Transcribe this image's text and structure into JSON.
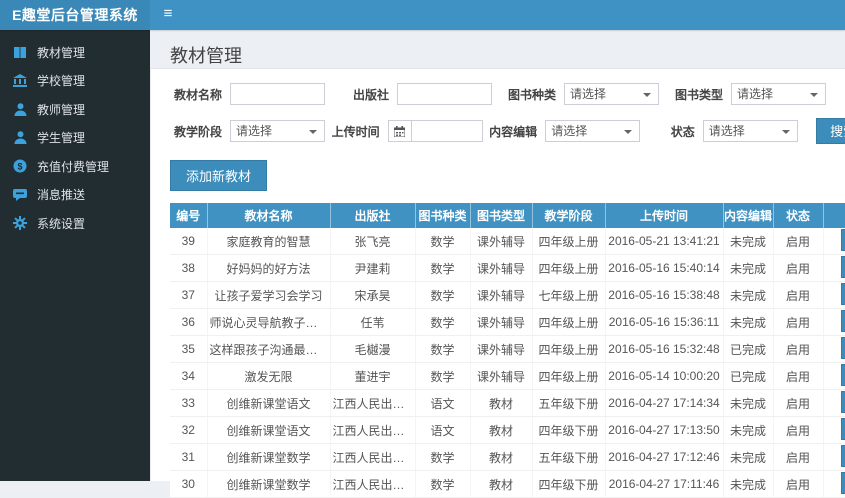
{
  "app": {
    "title": "E趣堂后台管理系统"
  },
  "topbar": {
    "menu_toggle": "≡"
  },
  "sidebar": {
    "items": [
      {
        "icon": "book-icon",
        "label": "教材管理"
      },
      {
        "icon": "school-icon",
        "label": "学校管理"
      },
      {
        "icon": "teacher-icon",
        "label": "教师管理"
      },
      {
        "icon": "student-icon",
        "label": "学生管理"
      },
      {
        "icon": "payment-icon",
        "label": "充值付费管理"
      },
      {
        "icon": "message-icon",
        "label": "消息推送"
      },
      {
        "icon": "settings-icon",
        "label": "系统设置"
      }
    ]
  },
  "page": {
    "title": "教材管理"
  },
  "filters": {
    "rows": [
      [
        {
          "label": "教材名称",
          "type": "text",
          "value": "",
          "placeholder": ""
        },
        {
          "label": "出版社",
          "type": "text",
          "value": "",
          "placeholder": ""
        },
        {
          "label": "图书种类",
          "type": "select",
          "value": "请选择"
        },
        {
          "label": "图书类型",
          "type": "select",
          "value": "请选择"
        }
      ],
      [
        {
          "label": "教学阶段",
          "type": "select",
          "value": "请选择"
        },
        {
          "label": "上传时间",
          "type": "date",
          "value": ""
        },
        {
          "label": "内容编辑",
          "type": "select",
          "value": "请选择"
        },
        {
          "label": "状态",
          "type": "select",
          "value": "请选择"
        }
      ]
    ],
    "search_label": "搜索"
  },
  "toolbar": {
    "add_label": "添加新教材"
  },
  "table": {
    "headers": [
      "编号",
      "教材名称",
      "出版社",
      "图书种类",
      "图书类型",
      "教学阶段",
      "上传时间",
      "内容编辑",
      "状态"
    ],
    "action_header": "",
    "rows": [
      [
        "39",
        "家庭教育的智慧",
        "张飞亮",
        "数学",
        "课外辅导",
        "四年级上册",
        "2016-05-21 13:41:21",
        "未完成",
        "启用"
      ],
      [
        "38",
        "好妈妈的好方法",
        "尹建莉",
        "数学",
        "课外辅导",
        "四年级上册",
        "2016-05-16 15:40:14",
        "未完成",
        "启用"
      ],
      [
        "37",
        "让孩子爱学习会学习",
        "宋承昊",
        "数学",
        "课外辅导",
        "七年级上册",
        "2016-05-16 15:38:48",
        "未完成",
        "启用"
      ],
      [
        "36",
        "师说心灵导航教子有方",
        "任苇",
        "数学",
        "课外辅导",
        "四年级上册",
        "2016-05-16 15:36:11",
        "未完成",
        "启用"
      ],
      [
        "35",
        "这样跟孩子沟通最有效",
        "毛樾漫",
        "数学",
        "课外辅导",
        "四年级上册",
        "2016-05-16 15:32:48",
        "已完成",
        "启用"
      ],
      [
        "34",
        "激发无限",
        "董进宇",
        "数学",
        "课外辅导",
        "四年级上册",
        "2016-05-14 10:00:20",
        "已完成",
        "启用"
      ],
      [
        "33",
        "创维新课堂语文",
        "江西人民出版社",
        "语文",
        "教材",
        "五年级下册",
        "2016-04-27 17:14:34",
        "未完成",
        "启用"
      ],
      [
        "32",
        "创维新课堂语文",
        "江西人民出版社",
        "语文",
        "教材",
        "四年级下册",
        "2016-04-27 17:13:50",
        "未完成",
        "启用"
      ],
      [
        "31",
        "创维新课堂数学",
        "江西人民出版社",
        "数学",
        "教材",
        "五年级下册",
        "2016-04-27 17:12:46",
        "未完成",
        "启用"
      ],
      [
        "30",
        "创维新课堂数学",
        "江西人民出版社",
        "数学",
        "教材",
        "四年级下册",
        "2016-04-27 17:11:46",
        "未完成",
        "启用"
      ]
    ]
  },
  "colors": {
    "topbar": "#3f93c4",
    "logo_bg": "#3a88b7",
    "sidebar_bg": "#222d32",
    "sidebar_icon": "#3ba2dd",
    "table_header_bg": "#3f92c2",
    "button_blue": "#3c8dbc",
    "content_bg": "#ecf0f5"
  }
}
